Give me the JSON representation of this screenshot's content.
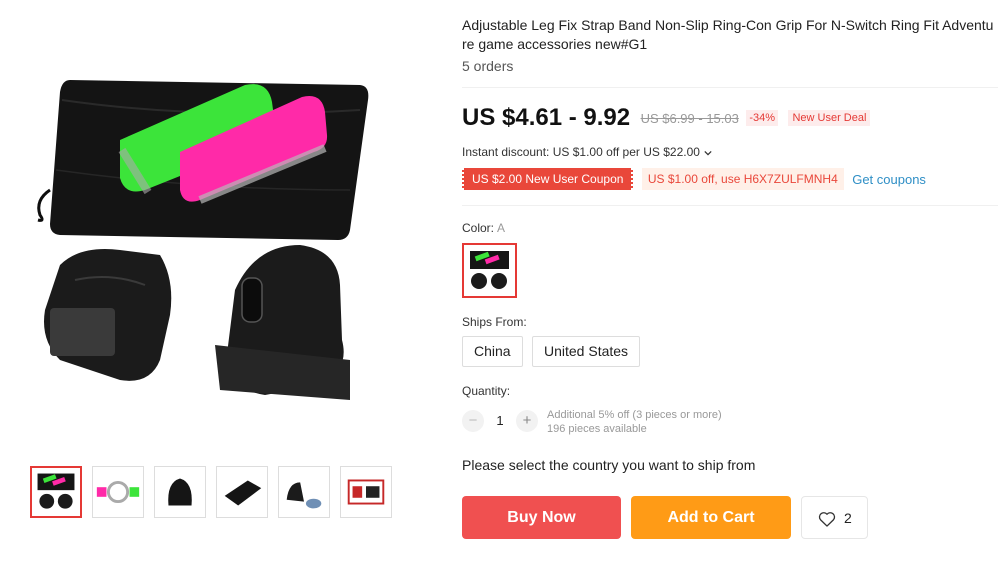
{
  "product": {
    "title": "Adjustable Leg Fix Strap Band Non-Slip Ring-Con Grip For N-Switch Ring Fit Adventure game accessories new#G1",
    "orders": "5 orders"
  },
  "price": {
    "current": "US $4.61 - 9.92",
    "original": "US $6.99 - 15.03",
    "discount": "-34%",
    "deal_tag": "New User Deal"
  },
  "instant_discount": "Instant discount: US $1.00 off per US $22.00",
  "coupons": {
    "new_user": "US $2.00 New User Coupon",
    "code_offer": "US $1.00 off, use H6X7ZULFMNH4",
    "link": "Get coupons"
  },
  "color": {
    "label": "Color:",
    "value": "A"
  },
  "ships_from": {
    "label": "Ships From:",
    "options": [
      "China",
      "United States"
    ]
  },
  "quantity": {
    "label": "Quantity:",
    "value": "1",
    "minus": "−",
    "plus": "+",
    "bulk_note": "Additional 5% off (3 pieces or more)",
    "available": "196 pieces available"
  },
  "ship_notice": "Please select the country you want to ship from",
  "actions": {
    "buy_now": "Buy Now",
    "add_to_cart": "Add to Cart",
    "wishlist_count": "2"
  },
  "colors": {
    "price_red": "#e53935",
    "buy_now_bg": "#f05050",
    "add_cart_bg": "#ff9b16",
    "coupon_red": "#e9473a",
    "coupon_link": "#2f8fc6"
  },
  "icons": {
    "wishlist": "heart-icon",
    "dropdown": "chevron-down-icon"
  }
}
